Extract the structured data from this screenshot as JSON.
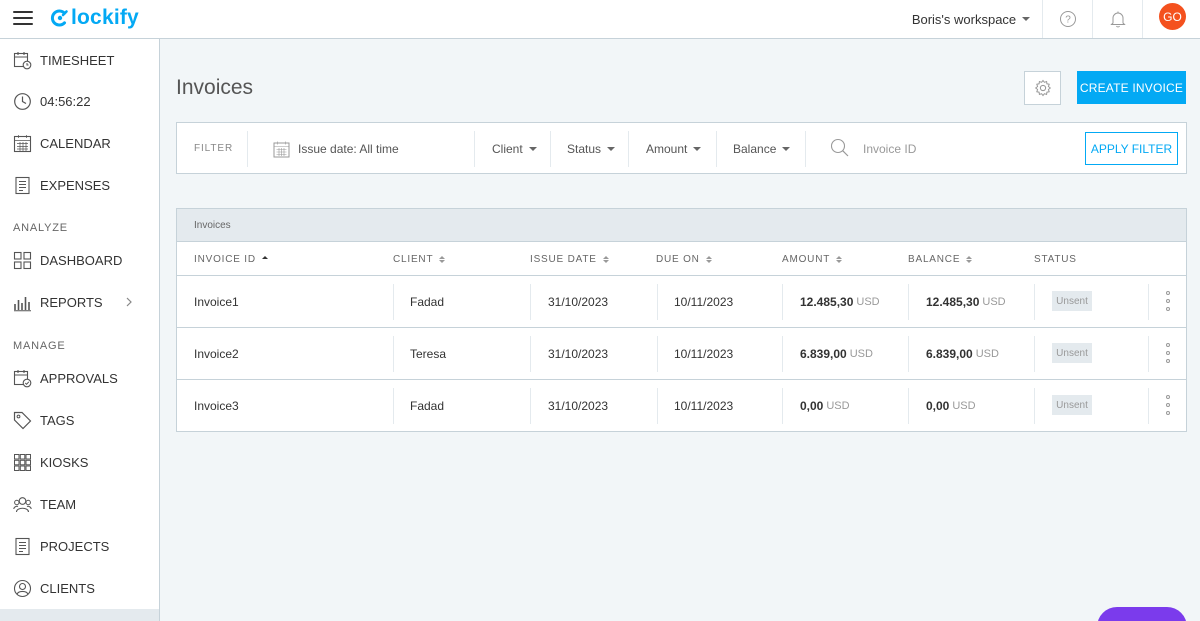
{
  "app": {
    "logo_text": "lockify",
    "workspace": "Boris's workspace",
    "avatar_initials": "GO",
    "accent_color": "#03a9f4",
    "avatar_color": "#f4511e"
  },
  "sidebar": {
    "items": [
      {
        "label": "TIMESHEET",
        "icon": "timesheet-icon"
      },
      {
        "label": "04:56:22",
        "icon": "clock-icon"
      },
      {
        "label": "CALENDAR",
        "icon": "calendar-icon"
      },
      {
        "label": "EXPENSES",
        "icon": "expenses-icon"
      }
    ],
    "analyze_label": "ANALYZE",
    "analyze_items": [
      {
        "label": "DASHBOARD",
        "icon": "dashboard-icon"
      },
      {
        "label": "REPORTS",
        "icon": "reports-icon"
      }
    ],
    "manage_label": "MANAGE",
    "manage_items": [
      {
        "label": "APPROVALS",
        "icon": "approvals-icon"
      },
      {
        "label": "TAGS",
        "icon": "tag-icon"
      },
      {
        "label": "KIOSKS",
        "icon": "kiosks-icon"
      },
      {
        "label": "TEAM",
        "icon": "team-icon"
      },
      {
        "label": "PROJECTS",
        "icon": "projects-icon"
      },
      {
        "label": "CLIENTS",
        "icon": "clients-icon"
      }
    ]
  },
  "main": {
    "title": "Invoices",
    "create_label": "CREATE INVOICE"
  },
  "filter": {
    "label": "FILTER",
    "issue_date": "Issue date: All time",
    "client": "Client",
    "status": "Status",
    "amount": "Amount",
    "balance": "Balance",
    "invoice_placeholder": "Invoice ID",
    "apply_label": "APPLY FILTER"
  },
  "table": {
    "caption": "Invoices",
    "columns": [
      "INVOICE ID",
      "CLIENT",
      "ISSUE DATE",
      "DUE ON",
      "AMOUNT",
      "BALANCE",
      "STATUS"
    ],
    "rows": [
      {
        "id": "Invoice1",
        "client": "Fadad",
        "issue": "31/10/2023",
        "due": "10/11/2023",
        "amount": "12.485,30",
        "amount_cur": "USD",
        "balance": "12.485,30",
        "balance_cur": "USD",
        "status": "Unsent"
      },
      {
        "id": "Invoice2",
        "client": "Teresa",
        "issue": "31/10/2023",
        "due": "10/11/2023",
        "amount": "6.839,00",
        "amount_cur": "USD",
        "balance": "6.839,00",
        "balance_cur": "USD",
        "status": "Unsent"
      },
      {
        "id": "Invoice3",
        "client": "Fadad",
        "issue": "31/10/2023",
        "due": "10/11/2023",
        "amount": "0,00",
        "amount_cur": "USD",
        "balance": "0,00",
        "balance_cur": "USD",
        "status": "Unsent"
      }
    ]
  }
}
